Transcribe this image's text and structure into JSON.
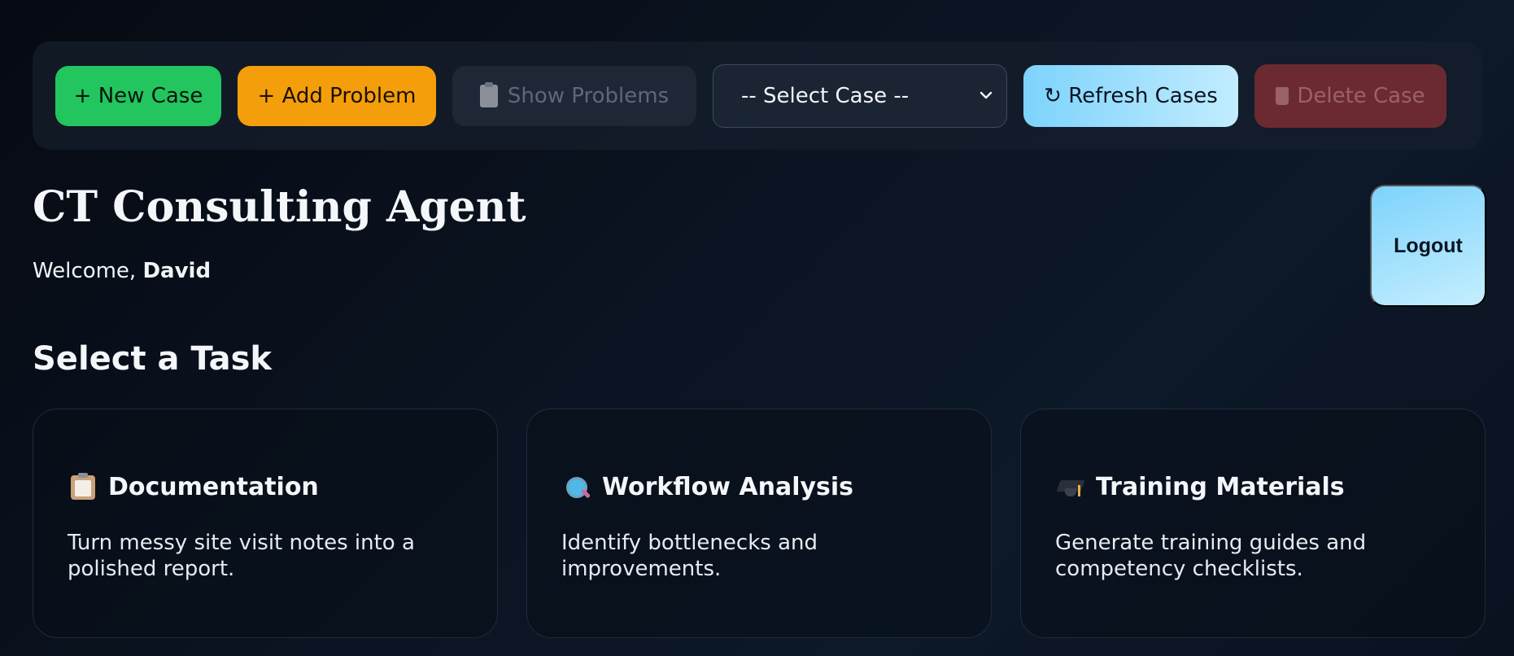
{
  "toolbar": {
    "new_case": "+ New Case",
    "add_problem": "+ Add Problem",
    "show_problems": "Show Problems",
    "select_case": "-- Select Case --",
    "refresh_cases": "↻ Refresh Cases",
    "delete_case": "Delete Case"
  },
  "header": {
    "title": "CT Consulting Agent",
    "welcome_prefix": "Welcome, ",
    "user_name": "David",
    "logout": "Logout"
  },
  "tasks": {
    "section_title": "Select a Task",
    "items": [
      {
        "title": "Documentation",
        "description": "Turn messy site visit notes into a polished report.",
        "icon": "clipboard-icon"
      },
      {
        "title": "Workflow Analysis",
        "description": "Identify bottlenecks and improvements.",
        "icon": "magnifier-icon"
      },
      {
        "title": "Training Materials",
        "description": "Generate training guides and competency checklists.",
        "icon": "graduation-cap-icon"
      }
    ]
  },
  "colors": {
    "new_case_green": "#22c55e",
    "add_problem_orange": "#f59e0b",
    "refresh_blue": "#7dd3fc",
    "delete_red_disabled": "#6b2a31"
  }
}
